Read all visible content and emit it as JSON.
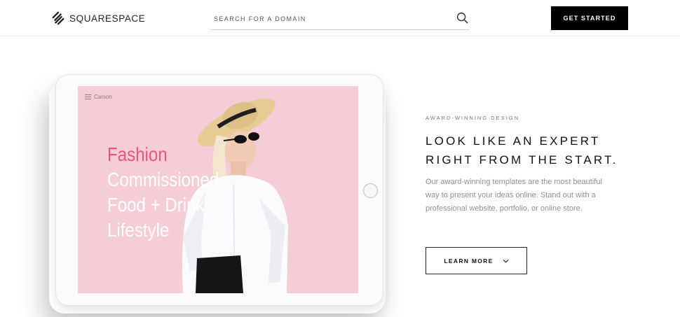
{
  "header": {
    "logo_text": "SQUARESPACE",
    "logo_icon": "squarespace-logo-icon",
    "search_placeholder": "SEARCH FOR A DOMAIN",
    "search_icon": "search-icon",
    "cta_label": "GET STARTED"
  },
  "tablet": {
    "site_name": "Carson",
    "menu_icon": "hamburger-menu-icon",
    "categories": [
      "Fashion",
      "Commissioned",
      "Food + Drink",
      "Lifestyle"
    ]
  },
  "feature": {
    "eyebrow": "AWARD-WINNING DESIGN",
    "headline_line1": "LOOK LIKE AN EXPERT",
    "headline_line2": "RIGHT FROM THE START.",
    "body": "Our award-winning templates are the most beautiful way to present your ideas online. Stand out with a professional website, portfolio, or online store.",
    "cta_label": "LEARN MORE",
    "cta_icon": "chevron-down-icon"
  },
  "colors": {
    "accent_pink": "#e9567f",
    "screen_background": "#f2c7d2",
    "cta_background": "#000000"
  }
}
